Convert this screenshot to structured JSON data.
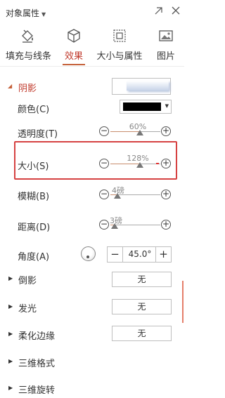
{
  "header": {
    "title": "对象属性",
    "caret": "▼"
  },
  "tabs": [
    {
      "label": "填充与线条",
      "icon": "fill-bucket-icon",
      "active": false
    },
    {
      "label": "效果",
      "icon": "cube-icon",
      "active": true
    },
    {
      "label": "大小与属性",
      "icon": "size-frame-icon",
      "active": false
    },
    {
      "label": "图片",
      "icon": "picture-icon",
      "active": false
    }
  ],
  "shadow": {
    "title": "阴影",
    "expanded": true,
    "color_label": "颜色(C)",
    "color_value": "#000000",
    "transparency_label": "透明度(T)",
    "transparency_value": "60%",
    "size_label": "大小(S)",
    "size_value": "128%",
    "blur_label": "模糊(B)",
    "blur_value": "4磅",
    "distance_label": "距离(D)",
    "distance_value": "3磅",
    "angle_label": "角度(A)",
    "angle_value": "45.0°",
    "minus": "−",
    "plus": "+"
  },
  "sections": {
    "reflection": {
      "label": "倒影",
      "value": "无"
    },
    "glow": {
      "label": "发光",
      "value": "无"
    },
    "soft_edges": {
      "label": "柔化边缘",
      "value": "无"
    },
    "format_3d": {
      "label": "三维格式"
    },
    "rotation_3d": {
      "label": "三维旋转"
    }
  },
  "colors": {
    "accent": "#c5613a",
    "highlight": "#d64141"
  }
}
